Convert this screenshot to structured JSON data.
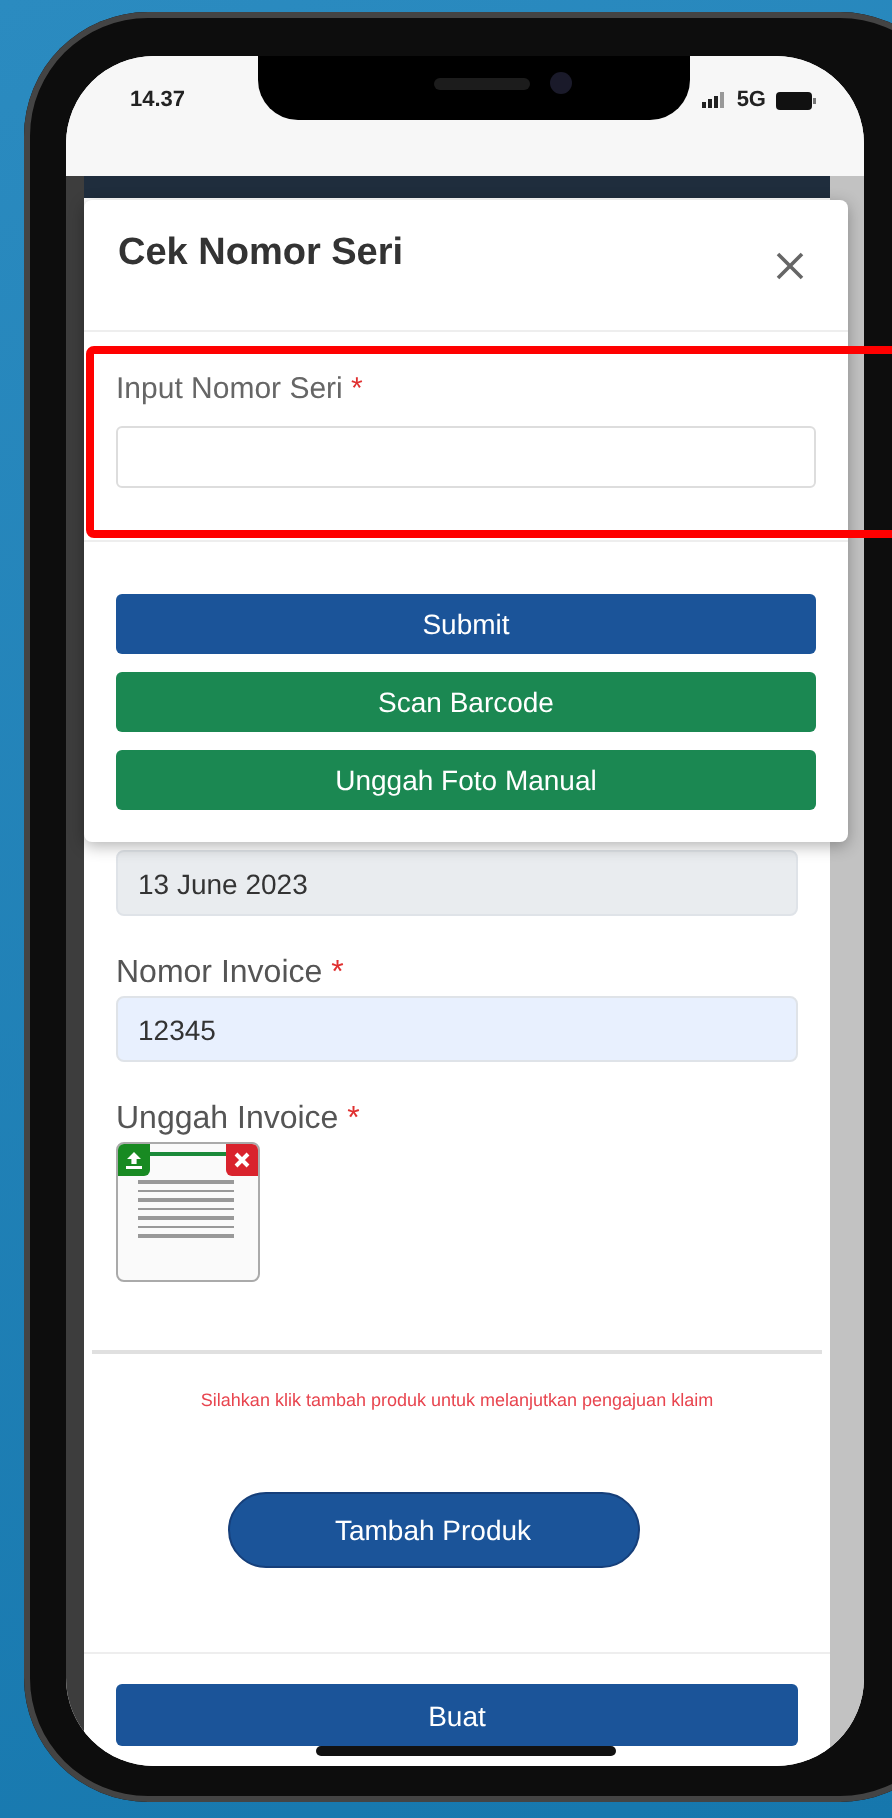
{
  "status_bar": {
    "time": "14.37",
    "network": "5G"
  },
  "modal": {
    "title": "Cek Nomor Seri",
    "field": {
      "label": "Input Nomor Seri",
      "required_mark": "*"
    },
    "buttons": [
      {
        "label": "Submit",
        "kind": "primary"
      },
      {
        "label": "Scan Barcode",
        "kind": "success"
      },
      {
        "label": "Unggah Foto Manual",
        "kind": "success"
      }
    ]
  },
  "form": {
    "date_field": {
      "value": "13 June 2023",
      "disabled": true
    },
    "invoice_number": {
      "label": "Nomor Invoice",
      "required_mark": "*",
      "value": "12345"
    },
    "invoice_upload": {
      "label": "Unggah Invoice",
      "required_mark": "*"
    },
    "hint": "Silahkan klik tambah produk untuk melanjutkan pengajuan klaim",
    "add_product_button": "Tambah Produk"
  },
  "create_button": "Buat"
}
